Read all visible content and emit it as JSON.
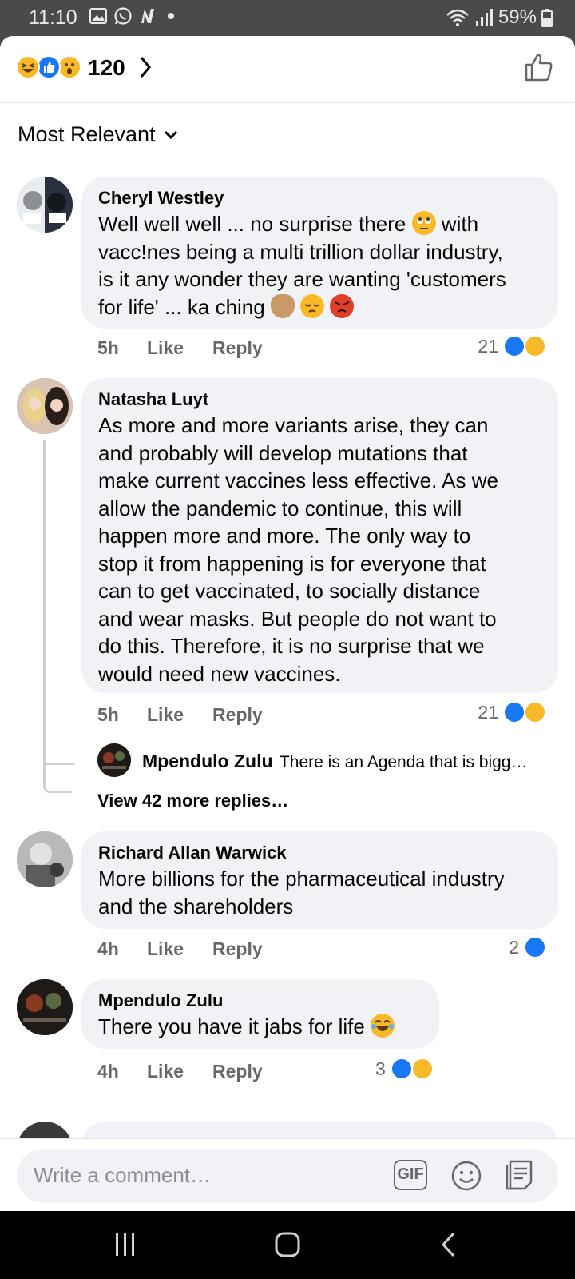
{
  "status_bar": {
    "time": "11:10",
    "battery": "59%"
  },
  "reactions": {
    "count": "120",
    "types": [
      "haha",
      "like",
      "wow"
    ]
  },
  "sort": {
    "label": "Most Relevant"
  },
  "comments": [
    {
      "author": "Cheryl Westley",
      "lines": [
        "Well well well ... no surprise there",
        "vacc!nes being a multi trillion dollar industry,",
        "is it any wonder they are wanting 'customers",
        "for life' ... ka ching"
      ],
      "inline_tail_1": "with",
      "time": "5h",
      "like": "Like",
      "reply": "Reply",
      "reaction_count": "21"
    },
    {
      "author": "Natasha Luyt",
      "lines": [
        "As more and more variants arise, they can",
        "and probably will develop mutations that",
        "make current vaccines less effective. As we",
        "allow the pandemic to continue, this will",
        "happen more and more. The only way to",
        "stop it from happening is for everyone that",
        "can to get vaccinated, to socially distance",
        "and wear masks. But people do not want to",
        "do this. Therefore, it is no surprise that we",
        "would need new vaccines."
      ],
      "time": "5h",
      "like": "Like",
      "reply": "Reply",
      "reaction_count": "21",
      "reply_preview": {
        "author": "Mpendulo Zulu",
        "text": "There is an Agenda that is bigg…"
      },
      "view_more": "View 42 more replies…"
    },
    {
      "author": "Richard Allan Warwick",
      "lines": [
        "More billions for the pharmaceutical industry",
        "and the shareholders"
      ],
      "time": "4h",
      "like": "Like",
      "reply": "Reply",
      "reaction_count": "2"
    },
    {
      "author": "Mpendulo Zulu",
      "lines": [
        "There you have it jabs for life"
      ],
      "time": "4h",
      "like": "Like",
      "reply": "Reply",
      "reaction_count": "3"
    }
  ],
  "composer": {
    "placeholder": "Write a comment…",
    "gif_label": "GIF"
  },
  "colors": {
    "accent": "#1877f2",
    "haha": "#f7b928",
    "bubble": "#f0f2f5",
    "meta": "#65676b"
  }
}
